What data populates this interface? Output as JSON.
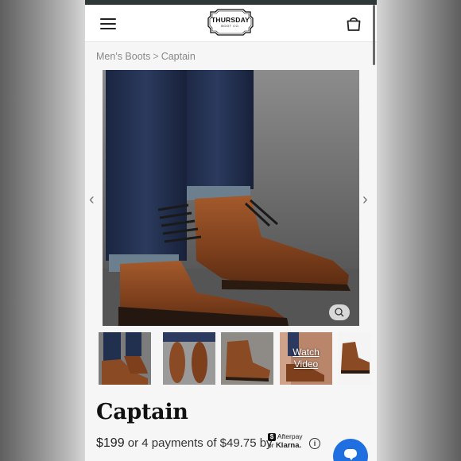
{
  "header": {
    "logo": {
      "brand": "THURSDAY",
      "sub": "BOOT CO."
    },
    "menu_icon": "hamburger-menu-icon",
    "cart_icon": "shopping-bag-icon"
  },
  "breadcrumb": {
    "parent": "Men's Boots",
    "separator": ">",
    "current": "Captain"
  },
  "gallery": {
    "thumbnails": [
      {
        "kind": "image",
        "selected": true
      },
      {
        "kind": "image",
        "selected": false
      },
      {
        "kind": "image",
        "selected": false
      },
      {
        "kind": "video",
        "label_line1": "Watch",
        "label_line2": "Video",
        "selected": false
      },
      {
        "kind": "image",
        "selected": false
      }
    ]
  },
  "product": {
    "title": "Captain",
    "price": "$199",
    "installments_text": "or 4 payments of $49.75 by",
    "afterpay_label": "Afterpay",
    "or_label": "or",
    "klarna_label": "Klarna."
  },
  "colors": {
    "accent": "#1f6fe0",
    "topbar": "#2e3838",
    "leather": "#8a4a24"
  }
}
